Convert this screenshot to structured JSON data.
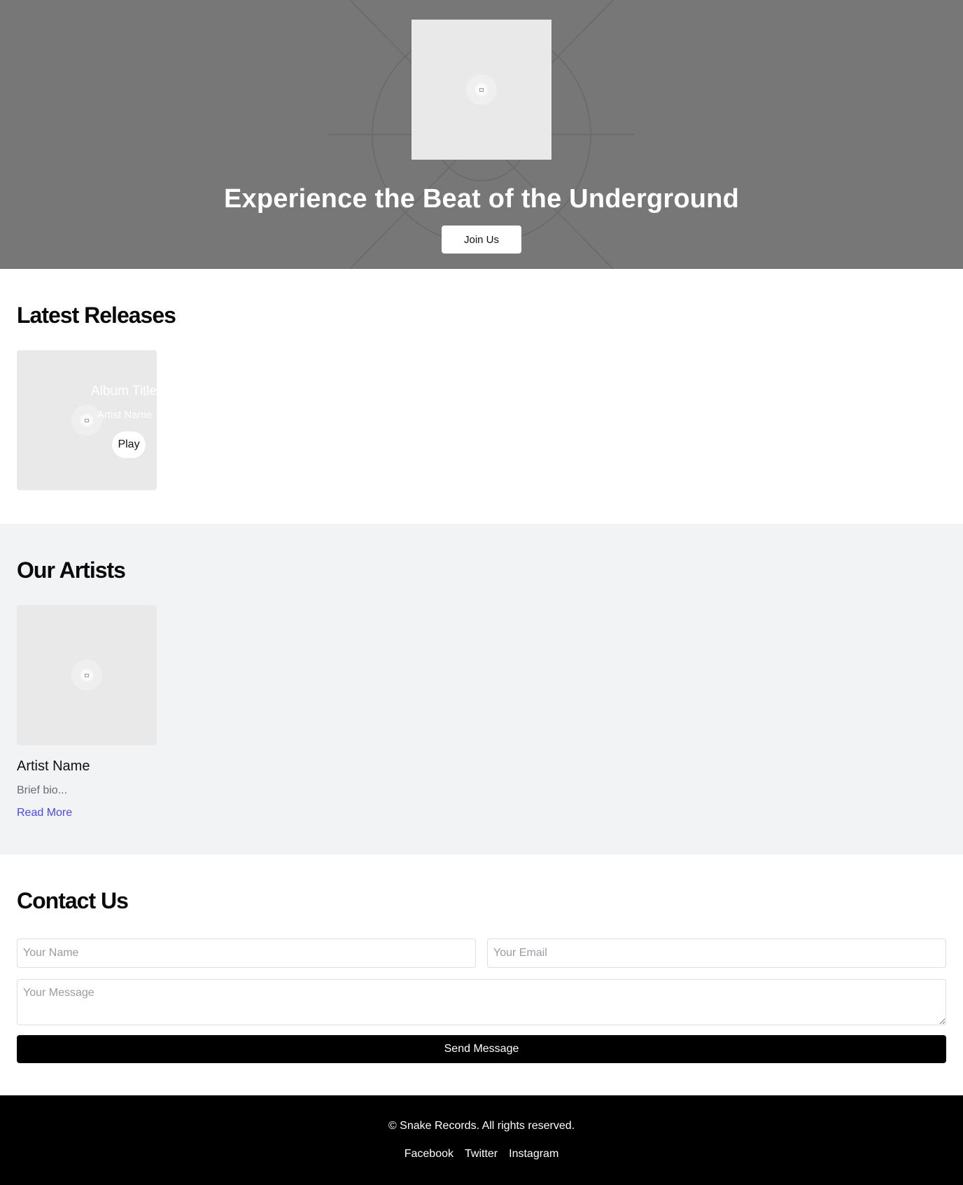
{
  "hero": {
    "title": "Experience the Beat of the Underground",
    "cta_label": "Join Us",
    "image_icon": "image-placeholder-icon"
  },
  "releases": {
    "heading": "Latest Releases",
    "items": [
      {
        "album_title": "Album Title",
        "artist": "Artist Name",
        "play_label": "Play"
      }
    ]
  },
  "artists": {
    "heading": "Our Artists",
    "items": [
      {
        "name": "Artist Name",
        "bio": "Brief bio...",
        "link_label": "Read More"
      }
    ]
  },
  "contact": {
    "heading": "Contact Us",
    "name_placeholder": "Your Name",
    "email_placeholder": "Your Email",
    "message_placeholder": "Your Message",
    "submit_label": "Send Message"
  },
  "footer": {
    "copyright": "© Snake Records. All rights reserved.",
    "links": [
      "Facebook",
      "Twitter",
      "Instagram"
    ]
  },
  "colors": {
    "hero_bg": "#777777",
    "artists_bg": "#f2f3f4",
    "link": "#4f46e5",
    "footer_bg": "#000000"
  }
}
